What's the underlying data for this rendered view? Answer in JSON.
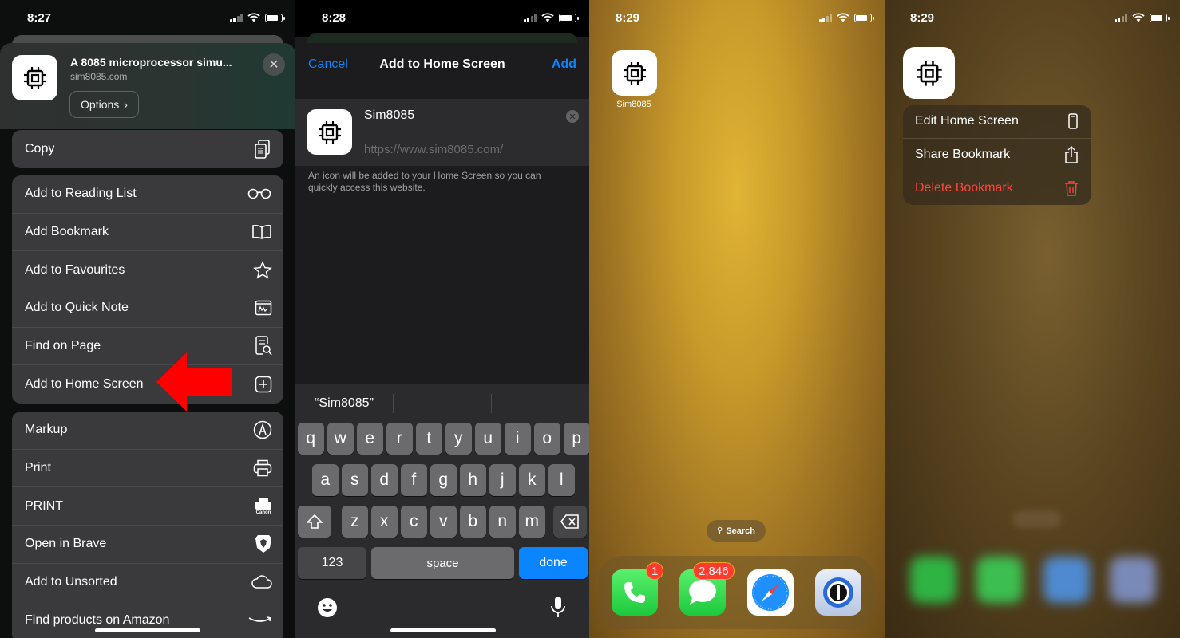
{
  "panel1": {
    "time": "8:27",
    "header": {
      "title": "A 8085 microprocessor simu...",
      "url": "sim8085.com",
      "options_label": "Options",
      "close_icon": "close-icon"
    },
    "group1": [
      {
        "label": "Copy",
        "icon": "copy-icon"
      }
    ],
    "group2": [
      {
        "label": "Add to Reading List",
        "icon": "glasses-icon"
      },
      {
        "label": "Add Bookmark",
        "icon": "book-icon"
      },
      {
        "label": "Add to Favourites",
        "icon": "star-icon"
      },
      {
        "label": "Add to Quick Note",
        "icon": "quick-note-icon"
      },
      {
        "label": "Find on Page",
        "icon": "find-on-page-icon"
      },
      {
        "label": "Add to Home Screen",
        "icon": "plus-square-icon"
      }
    ],
    "group3": [
      {
        "label": "Markup",
        "icon": "markup-icon"
      },
      {
        "label": "Print",
        "icon": "printer-icon"
      },
      {
        "label": "PRINT",
        "icon": "canon-print-icon"
      },
      {
        "label": "Open in Brave",
        "icon": "brave-icon"
      },
      {
        "label": "Add to Unsorted",
        "icon": "cloud-icon"
      },
      {
        "label": "Find products on Amazon",
        "icon": "amazon-icon"
      }
    ],
    "canon_text": "Canon",
    "arrow_color": "#ff0000"
  },
  "panel2": {
    "time": "8:28",
    "nav": {
      "cancel": "Cancel",
      "title": "Add to Home Screen",
      "add": "Add"
    },
    "name_value": "Sim8085",
    "url_value": "https://www.sim8085.com/",
    "hint": "An icon will be added to your Home Screen so you can quickly access this website.",
    "suggestion": "“Sim8085”",
    "keyboard": {
      "row1": [
        "q",
        "w",
        "e",
        "r",
        "t",
        "y",
        "u",
        "i",
        "o",
        "p"
      ],
      "row2": [
        "a",
        "s",
        "d",
        "f",
        "g",
        "h",
        "j",
        "k",
        "l"
      ],
      "row3": [
        "z",
        "x",
        "c",
        "v",
        "b",
        "n",
        "m"
      ],
      "numbers": "123",
      "space": "space",
      "done": "done"
    },
    "accent": "#0a84ff"
  },
  "panel3": {
    "time": "8:29",
    "app_label": "Sim8085",
    "search_label": "Search",
    "phone_badge": "1",
    "messages_badge": "2,846"
  },
  "panel4": {
    "time": "8:29",
    "menu": [
      {
        "label": "Edit Home Screen",
        "icon": "phone-outline-icon"
      },
      {
        "label": "Share Bookmark",
        "icon": "share-icon"
      },
      {
        "label": "Delete Bookmark",
        "icon": "trash-icon",
        "color": "#ff453a"
      }
    ]
  }
}
